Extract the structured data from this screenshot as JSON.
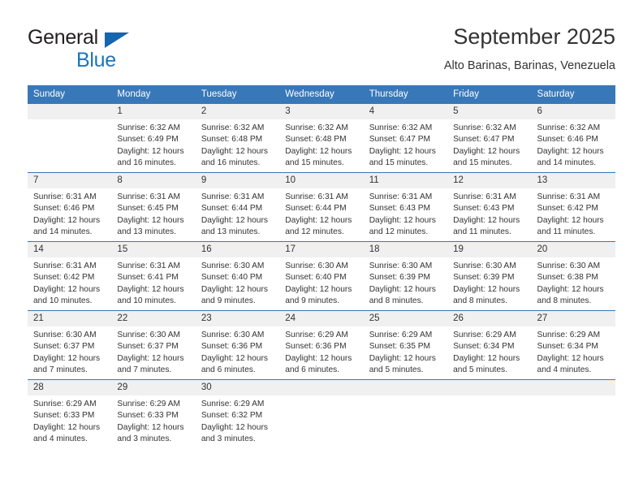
{
  "brand": {
    "word1": "General",
    "word2": "Blue",
    "triangle_color": "#1565b0",
    "blue_color": "#1b75bb"
  },
  "header": {
    "title": "September 2025",
    "subtitle": "Alto Barinas, Barinas, Venezuela"
  },
  "theme": {
    "header_bg": "#3878b8",
    "daynum_bg": "#f0f0f0",
    "row_border": "#3878b8",
    "text": "#333333"
  },
  "calendar": {
    "weekday_headers": [
      "Sunday",
      "Monday",
      "Tuesday",
      "Wednesday",
      "Thursday",
      "Friday",
      "Saturday"
    ],
    "weeks": [
      [
        {
          "day": "",
          "sunrise": "",
          "sunset": "",
          "daylight_1": "",
          "daylight_2": ""
        },
        {
          "day": "1",
          "sunrise": "Sunrise: 6:32 AM",
          "sunset": "Sunset: 6:49 PM",
          "daylight_1": "Daylight: 12 hours",
          "daylight_2": "and 16 minutes."
        },
        {
          "day": "2",
          "sunrise": "Sunrise: 6:32 AM",
          "sunset": "Sunset: 6:48 PM",
          "daylight_1": "Daylight: 12 hours",
          "daylight_2": "and 16 minutes."
        },
        {
          "day": "3",
          "sunrise": "Sunrise: 6:32 AM",
          "sunset": "Sunset: 6:48 PM",
          "daylight_1": "Daylight: 12 hours",
          "daylight_2": "and 15 minutes."
        },
        {
          "day": "4",
          "sunrise": "Sunrise: 6:32 AM",
          "sunset": "Sunset: 6:47 PM",
          "daylight_1": "Daylight: 12 hours",
          "daylight_2": "and 15 minutes."
        },
        {
          "day": "5",
          "sunrise": "Sunrise: 6:32 AM",
          "sunset": "Sunset: 6:47 PM",
          "daylight_1": "Daylight: 12 hours",
          "daylight_2": "and 15 minutes."
        },
        {
          "day": "6",
          "sunrise": "Sunrise: 6:32 AM",
          "sunset": "Sunset: 6:46 PM",
          "daylight_1": "Daylight: 12 hours",
          "daylight_2": "and 14 minutes."
        }
      ],
      [
        {
          "day": "7",
          "sunrise": "Sunrise: 6:31 AM",
          "sunset": "Sunset: 6:46 PM",
          "daylight_1": "Daylight: 12 hours",
          "daylight_2": "and 14 minutes."
        },
        {
          "day": "8",
          "sunrise": "Sunrise: 6:31 AM",
          "sunset": "Sunset: 6:45 PM",
          "daylight_1": "Daylight: 12 hours",
          "daylight_2": "and 13 minutes."
        },
        {
          "day": "9",
          "sunrise": "Sunrise: 6:31 AM",
          "sunset": "Sunset: 6:44 PM",
          "daylight_1": "Daylight: 12 hours",
          "daylight_2": "and 13 minutes."
        },
        {
          "day": "10",
          "sunrise": "Sunrise: 6:31 AM",
          "sunset": "Sunset: 6:44 PM",
          "daylight_1": "Daylight: 12 hours",
          "daylight_2": "and 12 minutes."
        },
        {
          "day": "11",
          "sunrise": "Sunrise: 6:31 AM",
          "sunset": "Sunset: 6:43 PM",
          "daylight_1": "Daylight: 12 hours",
          "daylight_2": "and 12 minutes."
        },
        {
          "day": "12",
          "sunrise": "Sunrise: 6:31 AM",
          "sunset": "Sunset: 6:43 PM",
          "daylight_1": "Daylight: 12 hours",
          "daylight_2": "and 11 minutes."
        },
        {
          "day": "13",
          "sunrise": "Sunrise: 6:31 AM",
          "sunset": "Sunset: 6:42 PM",
          "daylight_1": "Daylight: 12 hours",
          "daylight_2": "and 11 minutes."
        }
      ],
      [
        {
          "day": "14",
          "sunrise": "Sunrise: 6:31 AM",
          "sunset": "Sunset: 6:42 PM",
          "daylight_1": "Daylight: 12 hours",
          "daylight_2": "and 10 minutes."
        },
        {
          "day": "15",
          "sunrise": "Sunrise: 6:31 AM",
          "sunset": "Sunset: 6:41 PM",
          "daylight_1": "Daylight: 12 hours",
          "daylight_2": "and 10 minutes."
        },
        {
          "day": "16",
          "sunrise": "Sunrise: 6:30 AM",
          "sunset": "Sunset: 6:40 PM",
          "daylight_1": "Daylight: 12 hours",
          "daylight_2": "and 9 minutes."
        },
        {
          "day": "17",
          "sunrise": "Sunrise: 6:30 AM",
          "sunset": "Sunset: 6:40 PM",
          "daylight_1": "Daylight: 12 hours",
          "daylight_2": "and 9 minutes."
        },
        {
          "day": "18",
          "sunrise": "Sunrise: 6:30 AM",
          "sunset": "Sunset: 6:39 PM",
          "daylight_1": "Daylight: 12 hours",
          "daylight_2": "and 8 minutes."
        },
        {
          "day": "19",
          "sunrise": "Sunrise: 6:30 AM",
          "sunset": "Sunset: 6:39 PM",
          "daylight_1": "Daylight: 12 hours",
          "daylight_2": "and 8 minutes."
        },
        {
          "day": "20",
          "sunrise": "Sunrise: 6:30 AM",
          "sunset": "Sunset: 6:38 PM",
          "daylight_1": "Daylight: 12 hours",
          "daylight_2": "and 8 minutes."
        }
      ],
      [
        {
          "day": "21",
          "sunrise": "Sunrise: 6:30 AM",
          "sunset": "Sunset: 6:37 PM",
          "daylight_1": "Daylight: 12 hours",
          "daylight_2": "and 7 minutes."
        },
        {
          "day": "22",
          "sunrise": "Sunrise: 6:30 AM",
          "sunset": "Sunset: 6:37 PM",
          "daylight_1": "Daylight: 12 hours",
          "daylight_2": "and 7 minutes."
        },
        {
          "day": "23",
          "sunrise": "Sunrise: 6:30 AM",
          "sunset": "Sunset: 6:36 PM",
          "daylight_1": "Daylight: 12 hours",
          "daylight_2": "and 6 minutes."
        },
        {
          "day": "24",
          "sunrise": "Sunrise: 6:29 AM",
          "sunset": "Sunset: 6:36 PM",
          "daylight_1": "Daylight: 12 hours",
          "daylight_2": "and 6 minutes."
        },
        {
          "day": "25",
          "sunrise": "Sunrise: 6:29 AM",
          "sunset": "Sunset: 6:35 PM",
          "daylight_1": "Daylight: 12 hours",
          "daylight_2": "and 5 minutes."
        },
        {
          "day": "26",
          "sunrise": "Sunrise: 6:29 AM",
          "sunset": "Sunset: 6:34 PM",
          "daylight_1": "Daylight: 12 hours",
          "daylight_2": "and 5 minutes."
        },
        {
          "day": "27",
          "sunrise": "Sunrise: 6:29 AM",
          "sunset": "Sunset: 6:34 PM",
          "daylight_1": "Daylight: 12 hours",
          "daylight_2": "and 4 minutes."
        }
      ],
      [
        {
          "day": "28",
          "sunrise": "Sunrise: 6:29 AM",
          "sunset": "Sunset: 6:33 PM",
          "daylight_1": "Daylight: 12 hours",
          "daylight_2": "and 4 minutes."
        },
        {
          "day": "29",
          "sunrise": "Sunrise: 6:29 AM",
          "sunset": "Sunset: 6:33 PM",
          "daylight_1": "Daylight: 12 hours",
          "daylight_2": "and 3 minutes."
        },
        {
          "day": "30",
          "sunrise": "Sunrise: 6:29 AM",
          "sunset": "Sunset: 6:32 PM",
          "daylight_1": "Daylight: 12 hours",
          "daylight_2": "and 3 minutes."
        },
        {
          "day": "",
          "sunrise": "",
          "sunset": "",
          "daylight_1": "",
          "daylight_2": ""
        },
        {
          "day": "",
          "sunrise": "",
          "sunset": "",
          "daylight_1": "",
          "daylight_2": ""
        },
        {
          "day": "",
          "sunrise": "",
          "sunset": "",
          "daylight_1": "",
          "daylight_2": ""
        },
        {
          "day": "",
          "sunrise": "",
          "sunset": "",
          "daylight_1": "",
          "daylight_2": ""
        }
      ]
    ]
  }
}
